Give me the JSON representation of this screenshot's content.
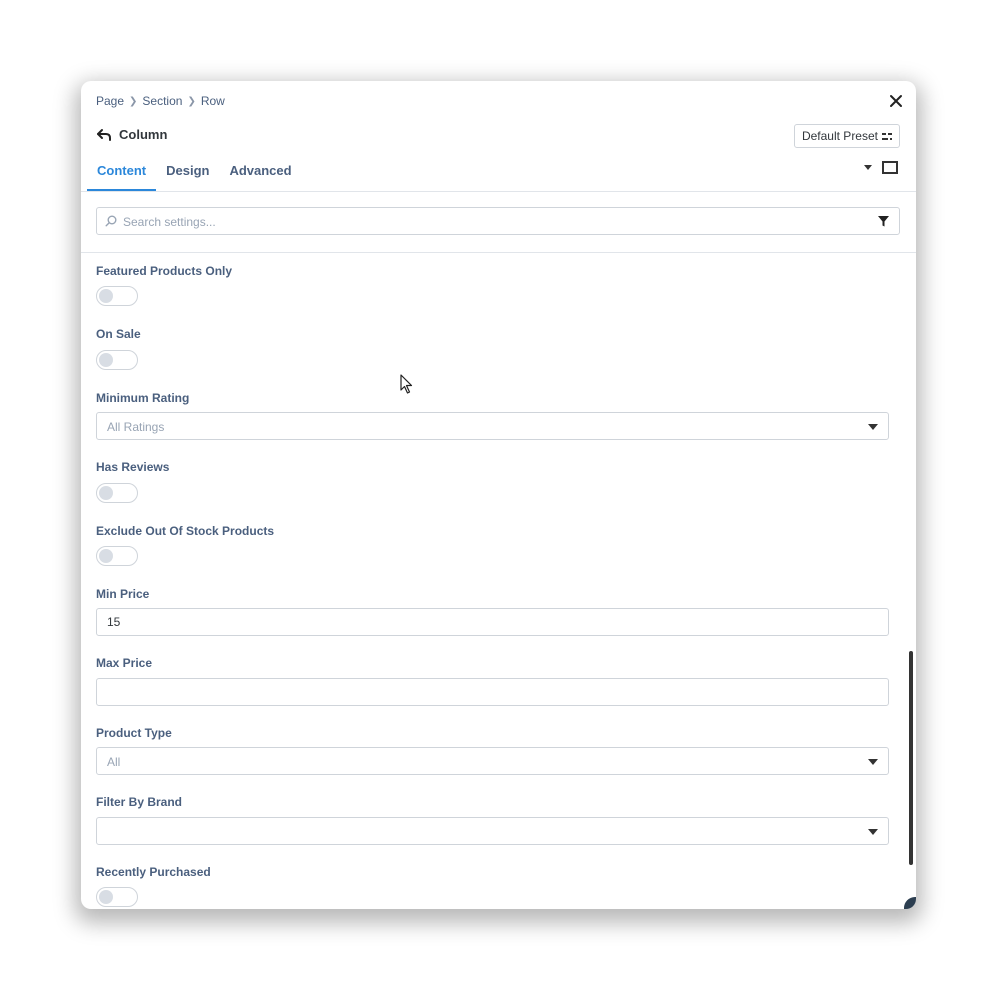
{
  "breadcrumb": [
    "Page",
    "Section",
    "Row"
  ],
  "header": {
    "title": "Column",
    "preset_label": "Default Preset"
  },
  "tabs": [
    {
      "label": "Content",
      "active": true
    },
    {
      "label": "Design",
      "active": false
    },
    {
      "label": "Advanced",
      "active": false
    }
  ],
  "search": {
    "placeholder": "Search settings..."
  },
  "fields": {
    "featured": {
      "label": "Featured Products Only",
      "on": false
    },
    "on_sale": {
      "label": "On Sale",
      "on": false
    },
    "min_rating": {
      "label": "Minimum Rating",
      "value": "All Ratings"
    },
    "has_reviews": {
      "label": "Has Reviews",
      "on": false
    },
    "exclude_oos": {
      "label": "Exclude Out Of Stock Products",
      "on": false
    },
    "min_price": {
      "label": "Min Price",
      "value": "15"
    },
    "max_price": {
      "label": "Max Price",
      "value": ""
    },
    "product_type": {
      "label": "Product Type",
      "value": "All"
    },
    "brand": {
      "label": "Filter By Brand",
      "value": ""
    },
    "recent": {
      "label": "Recently Purchased",
      "on": false
    }
  },
  "colors": {
    "accent": "#2b87da",
    "label": "#4a5f7e",
    "border": "#cfd4da"
  }
}
